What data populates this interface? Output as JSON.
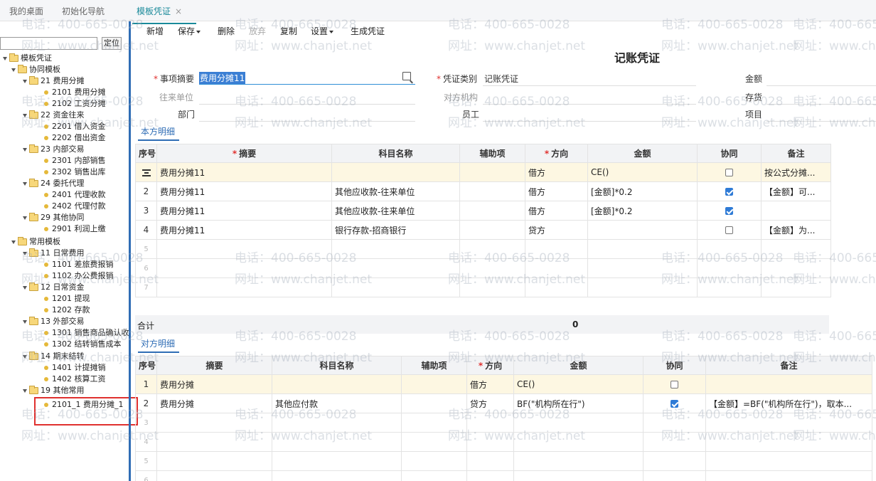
{
  "tabs": {
    "desktop": "我的桌面",
    "init_nav": "初始化导航",
    "template": "模板凭证",
    "close": "×"
  },
  "left": {
    "locate_button": "定位",
    "search_value": "",
    "tree": [
      "模板凭证",
      "协同模板",
      "21 费用分摊",
      "2101 费用分摊",
      "2102 工资分摊",
      "22 资金往来",
      "2201 借入资金",
      "2202 借出资金",
      "23 内部交易",
      "2301 内部销售",
      "2302 销售出库",
      "24 委托代理",
      "2401 代理收款",
      "2402 代理付款",
      "29 其他协同",
      "2901 利润上缴",
      "常用模板",
      "11 日常费用",
      "1101 差旅费报销",
      "1102 办公费报销",
      "12 日常资金",
      "1201 提现",
      "1202 存款",
      "13 外部交易",
      "1301 销售商品确认收",
      "1302 结转销售成本",
      "14 期末结转",
      "1401 计提摊销",
      "1402 核算工资",
      "19 其他常用",
      "2101_1 费用分摊_1"
    ]
  },
  "toolbar": {
    "new": "新增",
    "save": "保存",
    "delete": "删除",
    "discard": "放弃",
    "copy": "复制",
    "settings": "设置",
    "generate": "生成凭证"
  },
  "voucher": {
    "title": "记账凭证",
    "summary_label": "事项摘要",
    "summary_value": "费用分摊11",
    "category_label": "凭证类别",
    "category_value": "记账凭证",
    "amount_label": "金额",
    "partner_label": "往来单位",
    "counter_org_label": "对方机构",
    "inventory_label": "存货",
    "dept_label": "部门",
    "employee_label": "员工",
    "project_label": "项目"
  },
  "own_detail": {
    "tab": "本方明细",
    "headers": [
      "序号",
      "摘要",
      "科目名称",
      "辅助项",
      "方向",
      "金额",
      "协同",
      "备注"
    ],
    "rows": [
      {
        "idx": "",
        "summary": "费用分摊11",
        "account": "",
        "aux": "",
        "dir": "借方",
        "amount": "CE()",
        "sync": false,
        "note": "按公式分摊..."
      },
      {
        "idx": "2",
        "summary": "费用分摊11",
        "account": "其他应收款-往来单位",
        "aux": "",
        "dir": "借方",
        "amount": "[金额]*0.2",
        "sync": true,
        "note": "【金额】可..."
      },
      {
        "idx": "3",
        "summary": "费用分摊11",
        "account": "其他应收款-往来单位",
        "aux": "",
        "dir": "借方",
        "amount": "[金额]*0.2",
        "sync": true,
        "note": ""
      },
      {
        "idx": "4",
        "summary": "费用分摊11",
        "account": "银行存款-招商银行",
        "aux": "",
        "dir": "贷方",
        "amount": "",
        "sync": false,
        "note": "【金额】为..."
      }
    ],
    "empty_rows": [
      "5",
      "6",
      "7"
    ],
    "total_label": "合计",
    "total_value": "0"
  },
  "counter_detail": {
    "tab": "对方明细",
    "headers": [
      "序号",
      "摘要",
      "科目名称",
      "辅助项",
      "方向",
      "金额",
      "协同",
      "备注"
    ],
    "rows": [
      {
        "idx": "1",
        "summary": "费用分摊",
        "account": "",
        "aux": "",
        "dir": "借方",
        "amount": "CE()",
        "sync": false,
        "note": ""
      },
      {
        "idx": "2",
        "summary": "费用分摊",
        "account": "其他应付款",
        "aux": "",
        "dir": "贷方",
        "amount": "BF(\"机构所在行\")",
        "sync": true,
        "note": "【金额】=BF(\"机构所在行\")，取本..."
      }
    ],
    "empty_rows": [
      "3",
      "4",
      "5",
      "6"
    ]
  },
  "watermark": {
    "phone": "电话：400-665-0028",
    "site": "网址：www.chanjet.net"
  }
}
